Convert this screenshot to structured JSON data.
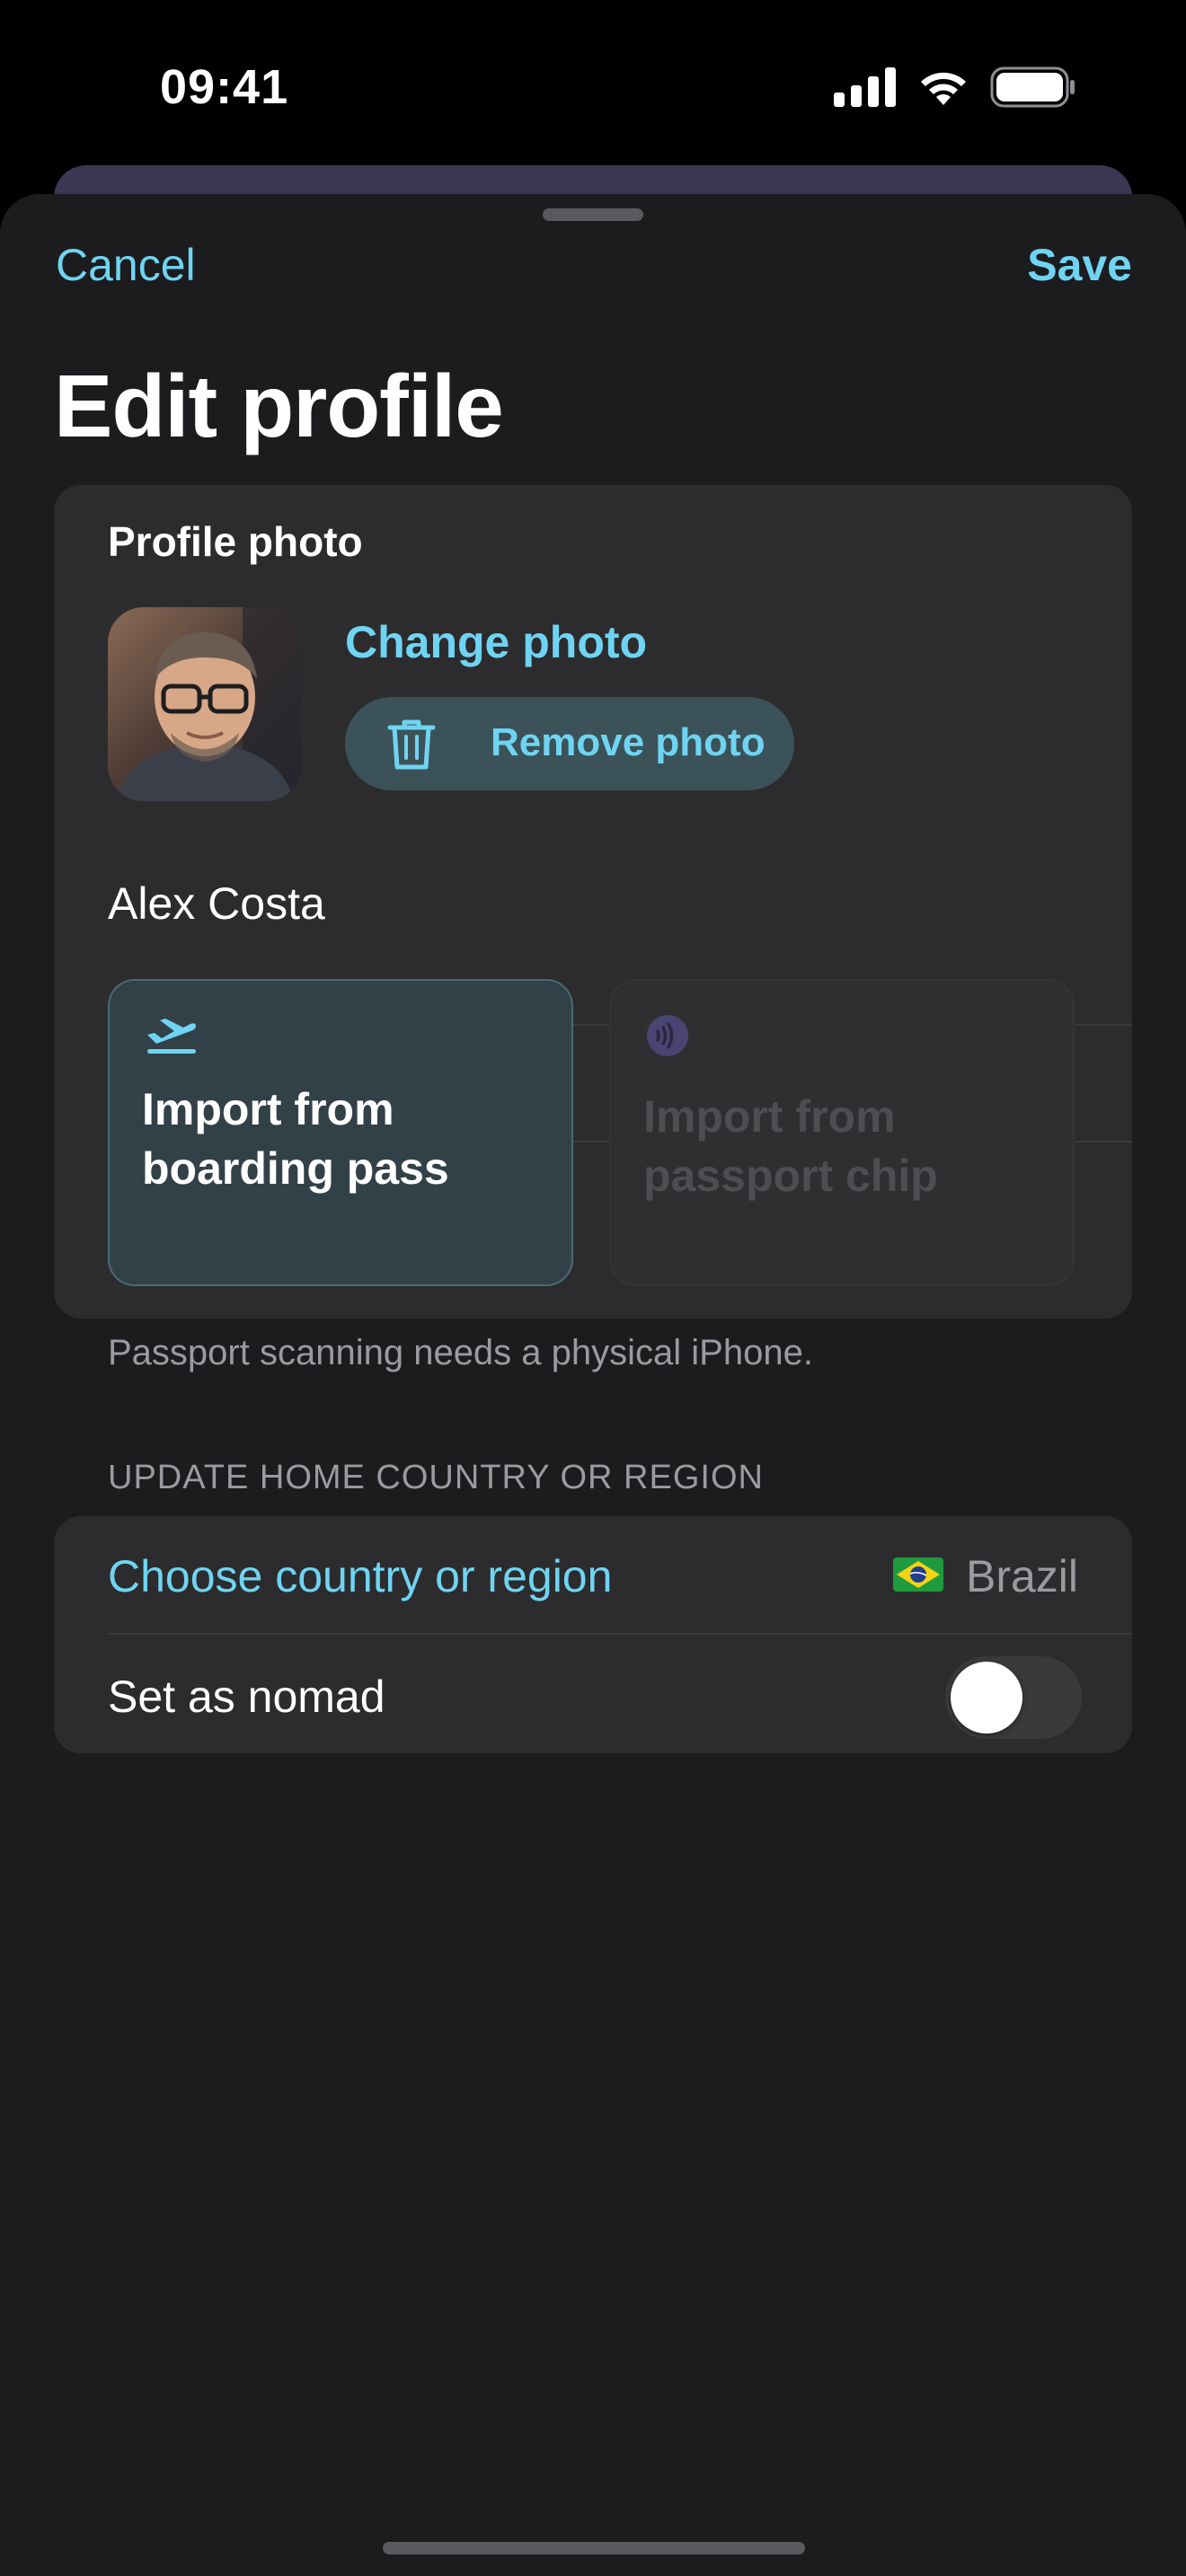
{
  "status_bar": {
    "time": "09:41",
    "icons": [
      "cellular-signal-icon",
      "wifi-icon",
      "battery-icon"
    ]
  },
  "nav": {
    "cancel_label": "Cancel",
    "save_label": "Save"
  },
  "page_title": "Edit profile",
  "profile": {
    "section_label": "Profile photo",
    "change_photo_label": "Change photo",
    "remove_photo_label": "Remove photo",
    "name": "Alex Costa"
  },
  "import": {
    "boarding_pass_label": "Import from\nboarding pass",
    "passport_chip_label": "Import from\npassport chip",
    "footnote": "Passport scanning needs a physical iPhone."
  },
  "home_country": {
    "section_header": "UPDATE HOME COUNTRY OR REGION",
    "choose_label": "Choose country or region",
    "country": "Brazil",
    "nomad_label": "Set as nomad",
    "nomad_enabled": false
  },
  "colors": {
    "accent": "#6fd4f2",
    "sheet_background": "#1c1c1e",
    "card_background": "#2c2c2e",
    "secondary_text": "#9a9aa0"
  }
}
